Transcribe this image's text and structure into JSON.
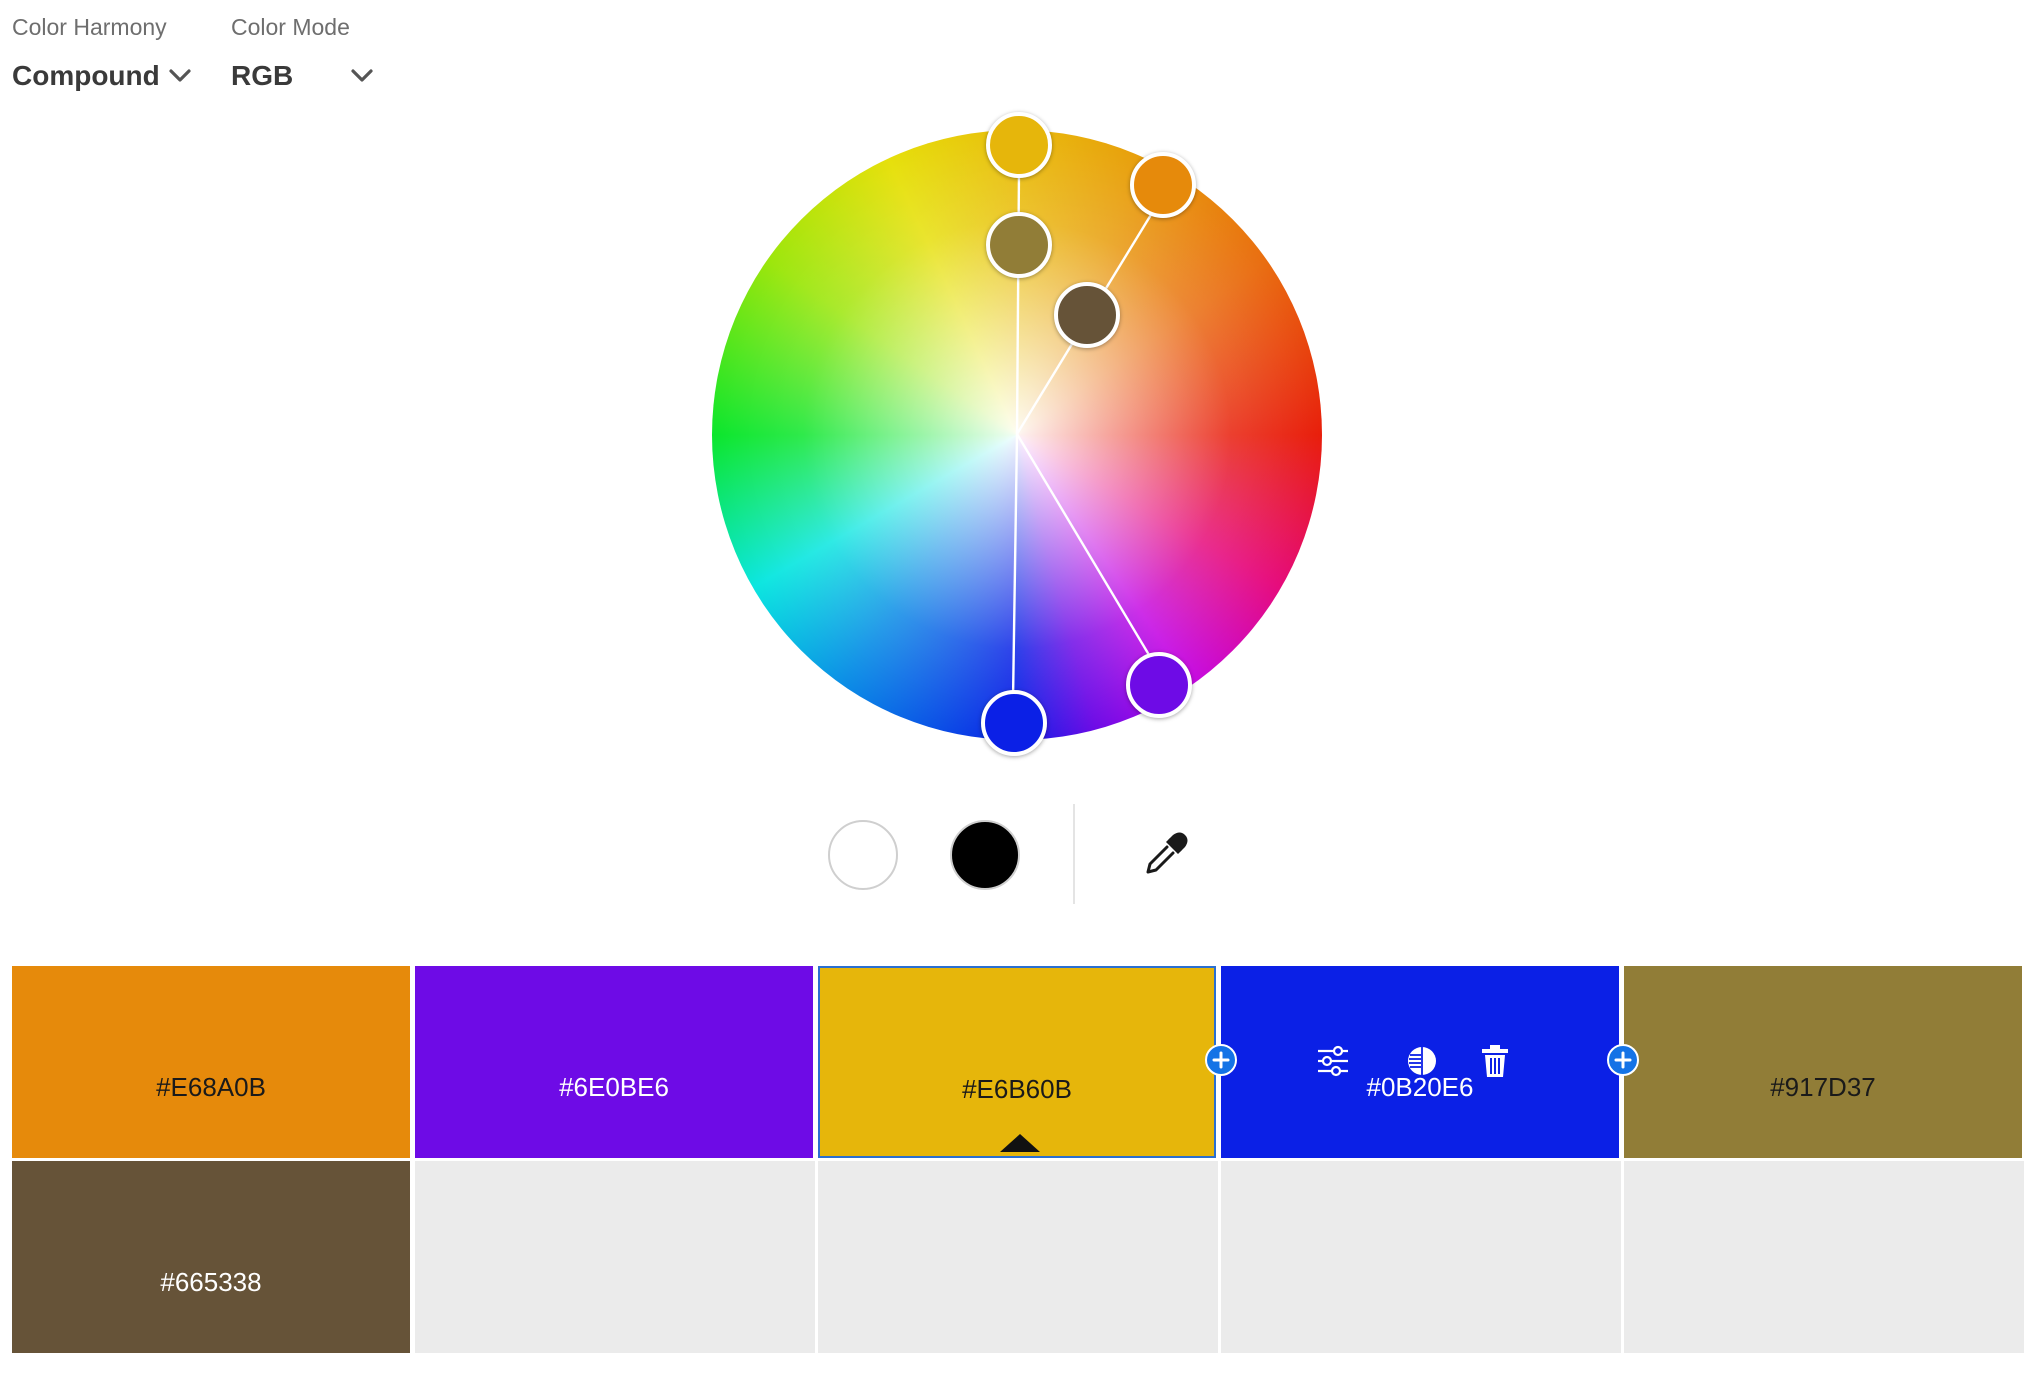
{
  "controls": {
    "harmony": {
      "label": "Color Harmony",
      "value": "Compound"
    },
    "mode": {
      "label": "Color Mode",
      "value": "RGB"
    }
  },
  "wheel_handles": [
    {
      "name": "base",
      "color": "#E6B60B"
    },
    {
      "name": "orange",
      "color": "#E68A0B"
    },
    {
      "name": "olive",
      "color": "#917D37"
    },
    {
      "name": "brown",
      "color": "#665338"
    },
    {
      "name": "purple",
      "color": "#6E0BE6"
    },
    {
      "name": "blue",
      "color": "#0B20E6"
    }
  ],
  "icons": {
    "chevron": "chevron-down-icon",
    "eyedropper": "eyedropper-icon",
    "add": "plus-icon",
    "adjust": "sliders-icon",
    "shade": "shade-icon",
    "delete": "trash-icon",
    "caret": "caret-up-icon"
  },
  "swatches": [
    {
      "hex": "#E68A0B",
      "text_color": "#1a1a1a"
    },
    {
      "hex": "#6E0BE6",
      "text_color": "#ffffff"
    },
    {
      "hex": "#E6B60B",
      "text_color": "#1a1a1a",
      "selected": true
    },
    {
      "hex": "#0B20E6",
      "text_color": "#ffffff",
      "hovered": true
    },
    {
      "hex": "#917D37",
      "text_color": "#1a1a1a"
    },
    {
      "hex": "#665338",
      "text_color": "#ffffff"
    }
  ],
  "colors": {
    "accent": "#1473E6",
    "selection_border": "#2A6FD1",
    "empty_cell": "#EBEBEB"
  }
}
